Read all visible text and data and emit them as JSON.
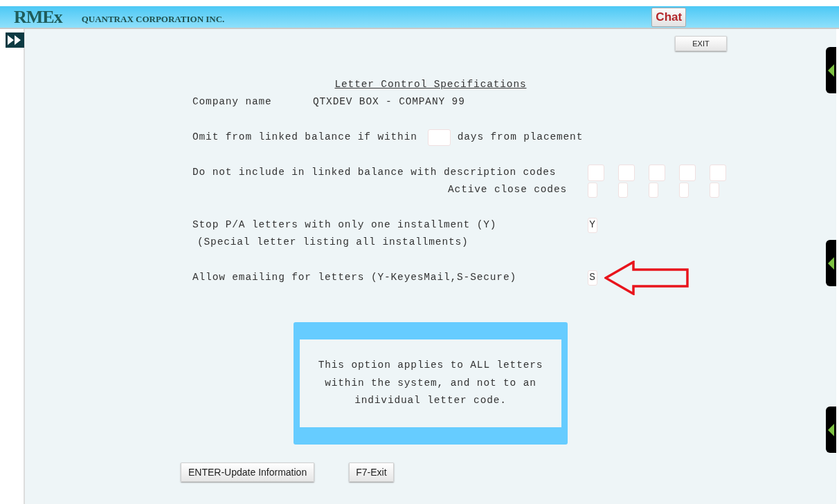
{
  "header": {
    "logo": "RMEx",
    "company": "QUANTRAX CORPORATION INC.",
    "chat_button": "Chat"
  },
  "exit_button": "EXIT",
  "title": "Letter Control Specifications",
  "company_row": {
    "label": "Company name",
    "value": "QTXDEV BOX - COMPANY 99"
  },
  "omit_row": {
    "label": "Omit from linked balance if within",
    "suffix": "days from placement"
  },
  "description_row": {
    "label": "Do not include in linked balance with description codes"
  },
  "close_row": {
    "label": "Active close codes"
  },
  "stop_row": {
    "label": "Stop P/A letters with only one installment (Y)",
    "value": "Y",
    "note": "(Special letter listing all installments)"
  },
  "email_row": {
    "label": "Allow emailing for letters (Y-KeyesMail,S-Secure)",
    "value": "S"
  },
  "info_box": "This option applies to ALL letters within the system, and not to an individual letter code.",
  "buttons": [
    "ENTER-Update Information",
    "F7-Exit"
  ]
}
